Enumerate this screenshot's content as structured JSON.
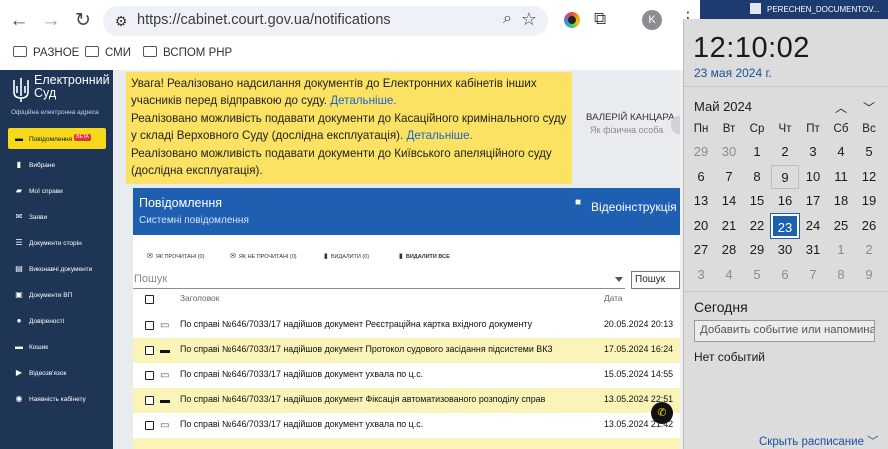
{
  "browser": {
    "url": "https://cabinet.court.gov.ua/notifications",
    "avatar_letter": "K",
    "bookmarks": [
      {
        "label": "РАЗНОЕ"
      },
      {
        "label": "СМИ"
      },
      {
        "label": "ВСПОМ РНР"
      }
    ]
  },
  "site": {
    "logo_line1": "Електронний",
    "logo_line2": "Суд",
    "logo_sub": "Офіційна електронна адреса"
  },
  "sidebar": {
    "items": [
      {
        "label": "Повідомлення",
        "icon": "message-icon",
        "badge": "BETA",
        "active": true
      },
      {
        "label": "Вибране",
        "icon": "bookmark-icon"
      },
      {
        "label": "Мої справи",
        "icon": "folder-icon"
      },
      {
        "label": "Заяви",
        "icon": "mail-icon"
      },
      {
        "label": "Документи сторін",
        "icon": "documents-icon"
      },
      {
        "label": "Виконавчі документи",
        "icon": "docs-stack-icon"
      },
      {
        "label": "Документи ВП",
        "icon": "book-icon"
      },
      {
        "label": "Довіреності",
        "icon": "people-icon"
      },
      {
        "label": "Кошик",
        "icon": "cart-icon"
      },
      {
        "label": "Відеозв'язок",
        "icon": "video-icon"
      },
      {
        "label": "Наявність кабінету",
        "icon": "person-icon"
      }
    ]
  },
  "notice": {
    "p1": "Увага! Реалізовано надсилання документів до Електронних кабінетів інших учасників перед відправкою до суду.",
    "p1_link": "Детальніше.",
    "p2": "Реалізовано можливість подавати документи до Касаційного кримінального суду у складі Верховного Суду (дослідна експлуатація).",
    "p2_link": "Детальніше.",
    "p3": "Реалізовано можливість подавати документи до Київського апеляційного суду (дослідна експлуатація)."
  },
  "user": {
    "name": "ВАЛЕРІЙ КАНЦАРА",
    "role": "Як фізична особа"
  },
  "panel": {
    "title": "Повідомлення",
    "subtitle": "Системні повідомлення",
    "video_label": "Відеоінструкція",
    "toolbar": {
      "mark_read": "ЯК ПРОЧИТАНІ (0)",
      "mark_unread": "ЯК НЕ ПРОЧИТАНІ (0)",
      "delete": "ВИДАЛИТИ (0)",
      "delete_all": "ВИДАЛИТИ ВСЕ"
    },
    "search_placeholder": "Пошук",
    "search_button": "Пошук",
    "columns": {
      "subject": "Заголовок",
      "date": "Дата"
    },
    "rows": [
      {
        "subject": "По справі №646/7033/17 надійшов документ Реєстраційна картка вхідного документу",
        "date": "20.05.2024 20:13",
        "highlight": false
      },
      {
        "subject": "По справі №646/7033/17 надійшов документ Протокол судового засідання підсистеми ВКЗ",
        "date": "17.05.2024 16:24",
        "highlight": true
      },
      {
        "subject": "По справі №646/7033/17 надійшов документ ухвала по ц.с.",
        "date": "15.05.2024 14:55",
        "highlight": false
      },
      {
        "subject": "По справі №646/7033/17 надійшов документ Фіксація автоматизованого розподілу справ",
        "date": "13.05.2024 22:51",
        "highlight": true
      },
      {
        "subject": "По справі №646/7033/17 надійшов документ ухвала по ц.с.",
        "date": "13.05.2024 21:42",
        "highlight": false
      }
    ]
  },
  "taskbar": {
    "window_title": "PERECHEN_DOCUMENTOV..."
  },
  "calendar": {
    "time": "12:10:02",
    "date_link": "23 мая 2024 г.",
    "month": "Май 2024",
    "weekdays": [
      "Пн",
      "Вт",
      "Ср",
      "Чт",
      "Пт",
      "Сб",
      "Вс"
    ],
    "weeks": [
      [
        "29",
        "30",
        "1",
        "2",
        "3",
        "4",
        "5"
      ],
      [
        "6",
        "7",
        "8",
        "9",
        "10",
        "11",
        "12"
      ],
      [
        "13",
        "14",
        "15",
        "16",
        "17",
        "18",
        "19"
      ],
      [
        "20",
        "21",
        "22",
        "23",
        "24",
        "25",
        "26"
      ],
      [
        "27",
        "28",
        "29",
        "30",
        "31",
        "1",
        "2"
      ],
      [
        "3",
        "4",
        "5",
        "6",
        "7",
        "8",
        "9"
      ]
    ],
    "today_label": "Сегодня",
    "add_event_placeholder": "Добавить событие или напоминание",
    "no_events": "Нет событий",
    "hide_schedule": "Скрыть расписание"
  }
}
